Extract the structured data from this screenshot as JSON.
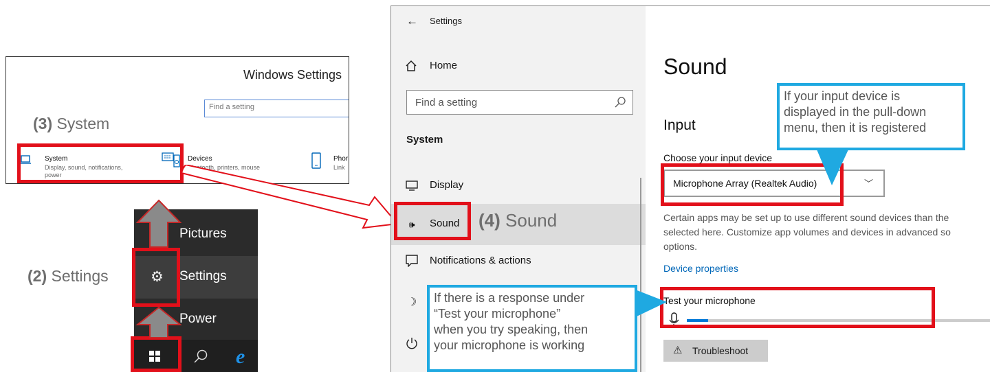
{
  "windows_settings": {
    "title": "Windows Settings",
    "search_placeholder": "Find a setting",
    "tiles": [
      {
        "title": "System",
        "subtitle_line1": "Display, sound, notifications,",
        "subtitle_line2": "power"
      },
      {
        "title": "Devices",
        "subtitle": "Bluetooth, printers, mouse"
      },
      {
        "title": "Phor",
        "subtitle": "Link"
      }
    ]
  },
  "start_menu": {
    "items": [
      {
        "label": "Pictures",
        "icon": "pictures-icon"
      },
      {
        "label": "Settings",
        "icon": "gear-icon"
      },
      {
        "label": "Power",
        "icon": "power-icon"
      }
    ],
    "taskbar": [
      "windows-start-icon",
      "search-icon",
      "edge-icon"
    ]
  },
  "steps": {
    "step2_num": "(2)",
    "step2_text": "Settings",
    "step3_num": "(3)",
    "step3_text": "System",
    "step4_num": "(4)",
    "step4_text": "Sound"
  },
  "settings_window": {
    "title": "Settings",
    "home_label": "Home",
    "search_placeholder": "Find a setting",
    "section": "System",
    "nav": [
      {
        "label": "Display",
        "icon": "display-icon"
      },
      {
        "label": "Sound",
        "icon": "sound-icon"
      },
      {
        "label": "Notifications & actions",
        "icon": "notifications-icon"
      },
      {
        "label": "",
        "icon": "focus-assist-icon"
      },
      {
        "label": "",
        "icon": "power-sleep-icon"
      }
    ]
  },
  "sound_page": {
    "title": "Sound",
    "input_heading": "Input",
    "choose_label": "Choose your input device",
    "selected_device": "Microphone Array (Realtek Audio)",
    "info_line1": "Certain apps may be set up to use different sound devices than the",
    "info_line2": "selected here. Customize app volumes and devices in advanced so",
    "info_line3": "options.",
    "device_properties_link": "Device properties",
    "test_label": "Test your microphone",
    "mic_level": 0.07,
    "troubleshoot_label": "Troubleshoot"
  },
  "callouts": {
    "registered": [
      "If your input device is",
      "displayed in the pull-down",
      "menu, then it is registered"
    ],
    "working": [
      "If there is a response under",
      "“Test your microphone”",
      "when you try speaking, then",
      "your microphone is working"
    ]
  },
  "colors": {
    "highlight_red": "#e2101a",
    "callout_blue": "#1fa9e1",
    "link_blue": "#0067b8",
    "accent_blue": "#0078d7"
  }
}
